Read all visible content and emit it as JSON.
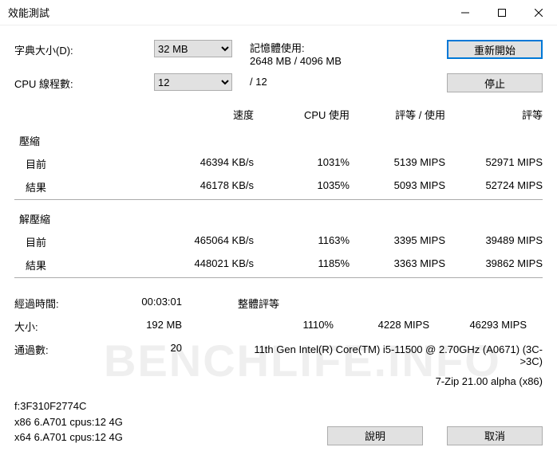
{
  "title": "效能測試",
  "dictSize": {
    "label": "字典大小(D):",
    "value": "32 MB"
  },
  "threads": {
    "label": "CPU 線程數:",
    "value": "12",
    "total": "/ 12"
  },
  "memory": {
    "label": "記憶體使用:",
    "value": "2648 MB / 4096 MB"
  },
  "btns": {
    "restart": "重新開始",
    "stop": "停止",
    "help": "說明",
    "cancel": "取消"
  },
  "cols": {
    "speed": "速度",
    "cpu": "CPU 使用",
    "rate": "評等 / 使用",
    "rating": "評等"
  },
  "compress": {
    "label": "壓縮",
    "current": {
      "label": "目前",
      "speed": "46394 KB/s",
      "cpu": "1031%",
      "rate": "5139 MIPS",
      "rating": "52971 MIPS"
    },
    "result": {
      "label": "結果",
      "speed": "46178 KB/s",
      "cpu": "1035%",
      "rate": "5093 MIPS",
      "rating": "52724 MIPS"
    }
  },
  "decompress": {
    "label": "解壓縮",
    "current": {
      "label": "目前",
      "speed": "465064 KB/s",
      "cpu": "1163%",
      "rate": "3395 MIPS",
      "rating": "39489 MIPS"
    },
    "result": {
      "label": "結果",
      "speed": "448021 KB/s",
      "cpu": "1185%",
      "rate": "3363 MIPS",
      "rating": "39862 MIPS"
    }
  },
  "elapsed": {
    "label": "經過時間:",
    "value": "00:03:01"
  },
  "size": {
    "label": "大小:",
    "value": "192 MB"
  },
  "passes": {
    "label": "通過數:",
    "value": "20"
  },
  "overall": {
    "label": "整體評等",
    "cpu": "1110%",
    "rate": "4228 MIPS",
    "rating": "46293 MIPS"
  },
  "cpuInfo": "11th Gen Intel(R) Core(TM) i5-11500 @ 2.70GHz (A0671) (3C->3C)",
  "zipInfo": "7-Zip 21.00 alpha (x86)",
  "sys": {
    "l1": "f:3F310F2774C",
    "l2": "x86 6.A701 cpus:12 4G",
    "l3": "x64 6.A701 cpus:12 4G"
  },
  "watermark": "BENCHLIFE.INFO"
}
